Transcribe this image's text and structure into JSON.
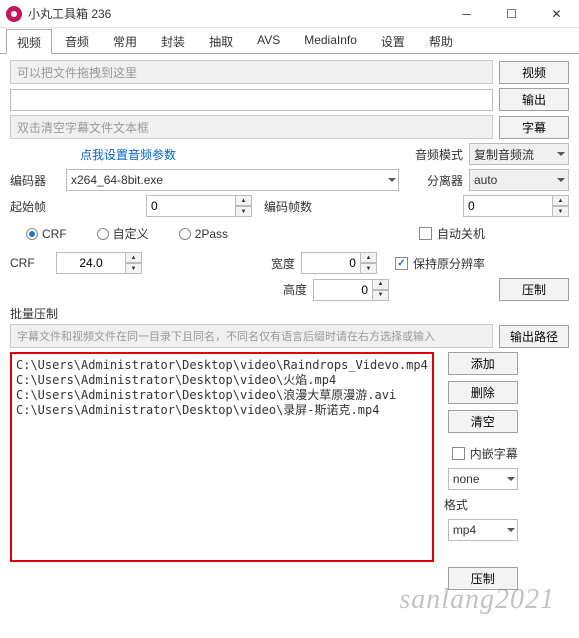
{
  "window": {
    "title": "小丸工具箱 236"
  },
  "tabs": [
    "视频",
    "音频",
    "常用",
    "封装",
    "抽取",
    "AVS",
    "MediaInfo",
    "设置",
    "帮助"
  ],
  "dropHints": {
    "video": "可以把文件拖拽到这里",
    "subtitle": "双击清空字幕文件文本框",
    "batch": "字幕文件和视频文件在同一目录下且同名，不同名仅有语言后缀时请在右方选择或输入"
  },
  "buttons": {
    "video": "视频",
    "output": "输出",
    "subtitle": "字幕",
    "compress": "压制",
    "outputPath": "输出路径",
    "add": "添加",
    "delete": "删除",
    "clear": "清空",
    "batchCompress": "压制"
  },
  "labels": {
    "audioParam": "点我设置音频参数",
    "audioMode": "音频模式",
    "encoder": "编码器",
    "demuxer": "分离器",
    "startFrame": "起始帧",
    "encodeFrames": "编码帧数",
    "crfRadio": "CRF",
    "custom": "自定义",
    "twopass": "2Pass",
    "autoShutdown": "自动关机",
    "crf": "CRF",
    "width": "宽度",
    "height": "高度",
    "keepRes": "保持原分辨率",
    "batchTitle": "批量压制",
    "embedSub": "内嵌字幕",
    "format": "格式"
  },
  "values": {
    "audioMode": "复制音频流",
    "encoder": "x264_64-8bit.exe",
    "demuxer": "auto",
    "startFrame": "0",
    "encodeFrames": "0",
    "crf": "24.0",
    "width": "0",
    "height": "0",
    "subLang": "none",
    "format": "mp4"
  },
  "files": [
    "C:\\Users\\Administrator\\Desktop\\video\\Raindrops_Videvo.mp4",
    "C:\\Users\\Administrator\\Desktop\\video\\火焰.mp4",
    "C:\\Users\\Administrator\\Desktop\\video\\浪漫大草原漫游.avi",
    "C:\\Users\\Administrator\\Desktop\\video\\录屏-斯诺克.mp4"
  ],
  "watermark": "sanlang2021"
}
